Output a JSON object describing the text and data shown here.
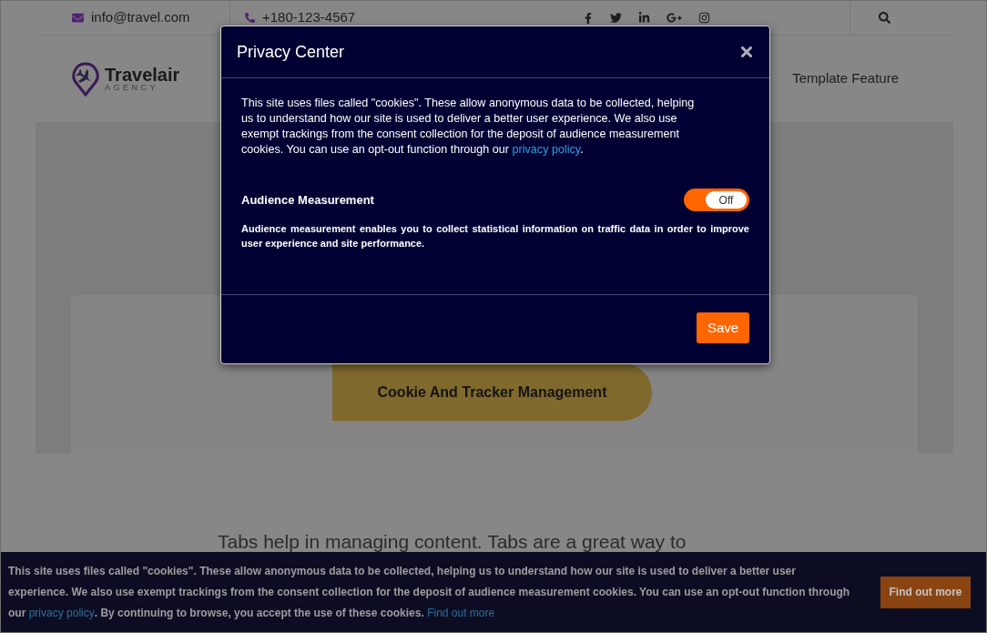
{
  "top_bar": {
    "email": "info@travel.com",
    "phone": "+180-123-4567"
  },
  "header": {
    "logo": {
      "name": "Travelair",
      "tagline": "AGENCY"
    },
    "nav": [
      {
        "label": "Template Feature"
      }
    ]
  },
  "hero": {
    "button": "Cookie And Tracker Management"
  },
  "intro": "Tabs help in managing content. Tabs are a great way to",
  "privacy_center": {
    "title": "Privacy Center",
    "notice": {
      "text": "This site uses files called \"cookies\". These allow anonymous data to be collected, helping us to understand how our site is used to deliver a better user experience. We also use exempt trackings from the consent collection for the deposit of audience measurement cookies. You can use an opt-out function through our",
      "link": "privacy policy",
      "end": "."
    },
    "settings": [
      {
        "label": "Audience Measurement",
        "on": false,
        "state_label": "Off",
        "description": "Audience measurement enables you to collect statistical information on traffic data in order to improve user experience and site performance."
      }
    ],
    "save_button": "Save"
  },
  "cookie_banner": {
    "text": "This site uses files called \"cookies\". These allow anonymous data to be collected, helping us to understand how our site is used to deliver a better user experience. We also use exempt trackings from the consent collection for the deposit of audience measurement cookies. You can use an opt-out function through our",
    "link": "privacy policy",
    "text_2": ". By continuing to browse, you accept the use of these cookies.",
    "link_2": "Find out more",
    "button": "Find out more"
  }
}
